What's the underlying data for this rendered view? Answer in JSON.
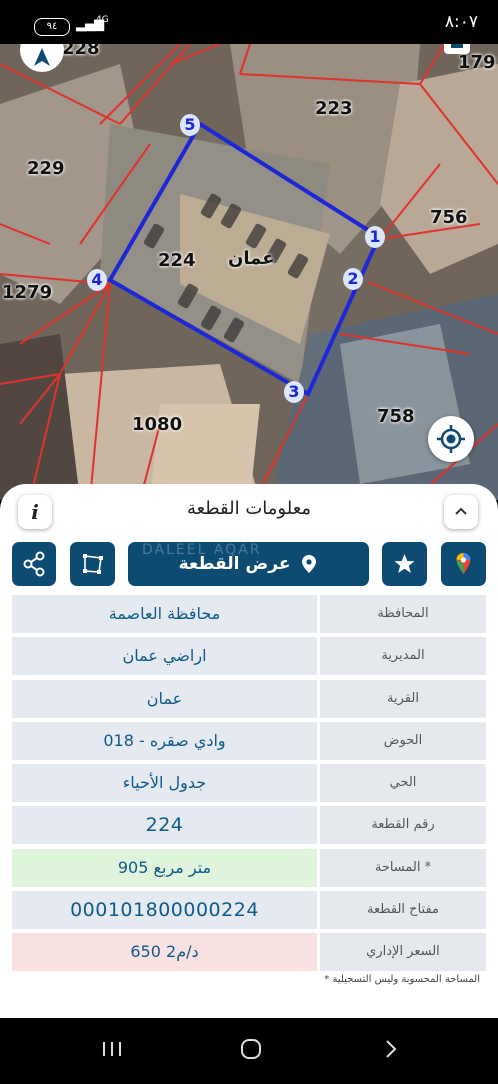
{
  "status_bar": {
    "time": "٨:٠٧",
    "battery": "٩٤",
    "network": "4G"
  },
  "map": {
    "parcel_numbers": [
      "228",
      "179",
      "223",
      "229",
      "756",
      "224",
      "1279",
      "758",
      "1080"
    ],
    "locality_label": "عمان",
    "vertex_labels": [
      "1",
      "2",
      "3",
      "4",
      "5"
    ],
    "colors": {
      "parcel_outline": "#1d27d6",
      "boundary_lines": "#e0322c"
    }
  },
  "sheet": {
    "title": "معلومات القطعة",
    "show_plot_label": "عرض القطعة",
    "watermark": "DALEEL AQAR",
    "rows": [
      {
        "label": "المحافظة",
        "value": "محافظة العاصمة"
      },
      {
        "label": "المديرية",
        "value": "اراضي عمان"
      },
      {
        "label": "القرية",
        "value": "عمان"
      },
      {
        "label": "الحوض",
        "value": "وادي صقره - 018"
      },
      {
        "label": "الحي",
        "value": "جدول الأحياء"
      },
      {
        "label": "رقم القطعة",
        "value": "224"
      },
      {
        "label": "المساحة *",
        "value": "905  متر مربع"
      },
      {
        "label": "مفتاح القطعة",
        "value": "000101800000224"
      },
      {
        "label": "السعر الإداري",
        "value": "650 د/م2"
      }
    ],
    "footnote": "* المساحة المحسوبة وليس التسجيلية"
  },
  "colors": {
    "accent": "#0e4b73",
    "value_text": "#0e5a8b",
    "area_bg": "#e0f3dd",
    "price_bg": "#f9e0e1"
  }
}
